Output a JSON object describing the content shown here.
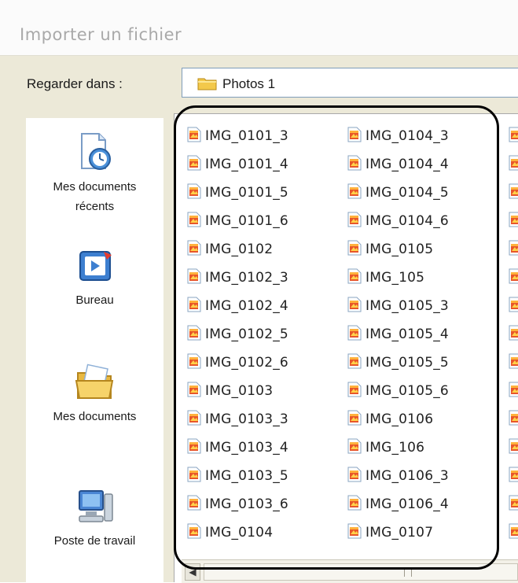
{
  "dialog": {
    "title": "Importer un fichier"
  },
  "lookin": {
    "label": "Regarder dans :",
    "current_folder": "Photos 1",
    "folder_icon": "folder-icon"
  },
  "places": [
    {
      "label_line1": "Mes documents",
      "label_line2": "récents",
      "icon": "recent-documents-icon"
    },
    {
      "label_line1": "Bureau",
      "label_line2": "",
      "icon": "desktop-icon"
    },
    {
      "label_line1": "Mes documents",
      "label_line2": "",
      "icon": "my-documents-icon"
    },
    {
      "label_line1": "Poste de travail",
      "label_line2": "",
      "icon": "my-computer-icon"
    }
  ],
  "files": {
    "column1": [
      "IMG_0101_3",
      "IMG_0101_4",
      "IMG_0101_5",
      "IMG_0101_6",
      "IMG_0102",
      "IMG_0102_3",
      "IMG_0102_4",
      "IMG_0102_5",
      "IMG_0102_6",
      "IMG_0103",
      "IMG_0103_3",
      "IMG_0103_4",
      "IMG_0103_5",
      "IMG_0103_6",
      "IMG_0104"
    ],
    "column2": [
      "IMG_0104_3",
      "IMG_0104_4",
      "IMG_0104_5",
      "IMG_0104_6",
      "IMG_0105",
      "IMG_105",
      "IMG_0105_3",
      "IMG_0105_4",
      "IMG_0105_5",
      "IMG_0105_6",
      "IMG_0106",
      "IMG_106",
      "IMG_0106_3",
      "IMG_0106_4",
      "IMG_0107"
    ],
    "file_icon": "image-file-icon"
  },
  "colors": {
    "highlight": "#000000",
    "title_text": "#a9a9a9",
    "combo_border": "#7f9db9"
  }
}
